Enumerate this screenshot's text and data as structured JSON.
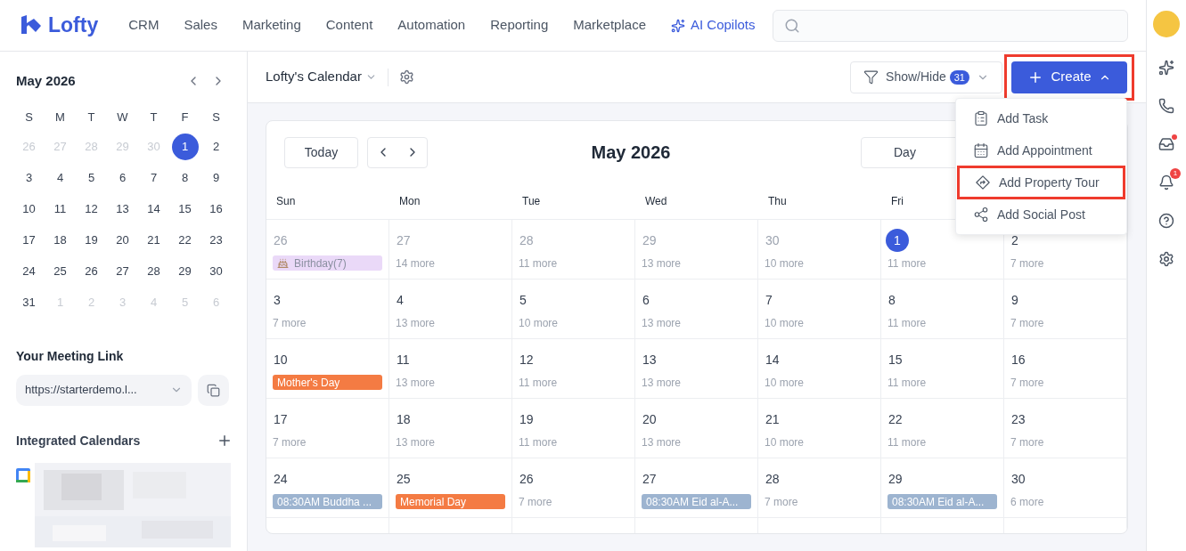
{
  "nav": {
    "logo": "Lofty",
    "items": [
      {
        "label": "CRM",
        "kind": "plain"
      },
      {
        "label": "Sales",
        "kind": "plain"
      },
      {
        "label": "Marketing",
        "kind": "plain"
      },
      {
        "label": "Content",
        "kind": "plain"
      },
      {
        "label": "Automation",
        "kind": "plain"
      },
      {
        "label": "Reporting",
        "kind": "plain"
      },
      {
        "label": "Marketplace",
        "kind": "plain"
      },
      {
        "label": "AI Copilots",
        "kind": "ai"
      }
    ]
  },
  "rail": {
    "inbox_unread": true,
    "notifications_badge": "1"
  },
  "mini_calendar": {
    "title": "May 2026",
    "weekdays": [
      "S",
      "M",
      "T",
      "W",
      "T",
      "F",
      "S"
    ],
    "weeks": [
      [
        {
          "day": "26",
          "muted": true,
          "selected": false
        },
        {
          "day": "27",
          "muted": true,
          "selected": false
        },
        {
          "day": "28",
          "muted": true,
          "selected": false
        },
        {
          "day": "29",
          "muted": true,
          "selected": false
        },
        {
          "day": "30",
          "muted": true,
          "selected": false
        },
        {
          "day": "1",
          "muted": false,
          "selected": true
        },
        {
          "day": "2",
          "muted": false,
          "selected": false
        }
      ],
      [
        {
          "day": "3",
          "muted": false,
          "selected": false
        },
        {
          "day": "4",
          "muted": false,
          "selected": false
        },
        {
          "day": "5",
          "muted": false,
          "selected": false
        },
        {
          "day": "6",
          "muted": false,
          "selected": false
        },
        {
          "day": "7",
          "muted": false,
          "selected": false
        },
        {
          "day": "8",
          "muted": false,
          "selected": false
        },
        {
          "day": "9",
          "muted": false,
          "selected": false
        }
      ],
      [
        {
          "day": "10",
          "muted": false,
          "selected": false
        },
        {
          "day": "11",
          "muted": false,
          "selected": false
        },
        {
          "day": "12",
          "muted": false,
          "selected": false
        },
        {
          "day": "13",
          "muted": false,
          "selected": false
        },
        {
          "day": "14",
          "muted": false,
          "selected": false
        },
        {
          "day": "15",
          "muted": false,
          "selected": false
        },
        {
          "day": "16",
          "muted": false,
          "selected": false
        }
      ],
      [
        {
          "day": "17",
          "muted": false,
          "selected": false
        },
        {
          "day": "18",
          "muted": false,
          "selected": false
        },
        {
          "day": "19",
          "muted": false,
          "selected": false
        },
        {
          "day": "20",
          "muted": false,
          "selected": false
        },
        {
          "day": "21",
          "muted": false,
          "selected": false
        },
        {
          "day": "22",
          "muted": false,
          "selected": false
        },
        {
          "day": "23",
          "muted": false,
          "selected": false
        }
      ],
      [
        {
          "day": "24",
          "muted": false,
          "selected": false
        },
        {
          "day": "25",
          "muted": false,
          "selected": false
        },
        {
          "day": "26",
          "muted": false,
          "selected": false
        },
        {
          "day": "27",
          "muted": false,
          "selected": false
        },
        {
          "day": "28",
          "muted": false,
          "selected": false
        },
        {
          "day": "29",
          "muted": false,
          "selected": false
        },
        {
          "day": "30",
          "muted": false,
          "selected": false
        }
      ],
      [
        {
          "day": "31",
          "muted": false,
          "selected": false
        },
        {
          "day": "1",
          "muted": true,
          "selected": false
        },
        {
          "day": "2",
          "muted": true,
          "selected": false
        },
        {
          "day": "3",
          "muted": true,
          "selected": false
        },
        {
          "day": "4",
          "muted": true,
          "selected": false
        },
        {
          "day": "5",
          "muted": true,
          "selected": false
        },
        {
          "day": "6",
          "muted": true,
          "selected": false
        }
      ]
    ]
  },
  "meeting_link": {
    "title": "Your Meeting Link",
    "value": "https://starterdemo.l..."
  },
  "integrated_calendars": {
    "title": "Integrated Calendars"
  },
  "toolbar": {
    "calendar_name": "Lofty's Calendar",
    "show_hide": {
      "label": "Show/Hide",
      "count": "31"
    },
    "create": {
      "label": "Create",
      "highlighted": true
    }
  },
  "create_menu": [
    {
      "label": "Add Task",
      "kind": "task",
      "highlighted": false
    },
    {
      "label": "Add Appointment",
      "kind": "appointment",
      "highlighted": false
    },
    {
      "label": "Add Property Tour",
      "kind": "tour",
      "highlighted": true
    },
    {
      "label": "Add Social Post",
      "kind": "social",
      "highlighted": false
    }
  ],
  "calendar": {
    "today_button": "Today",
    "title": "May 2026",
    "view": "Day",
    "weekdays": [
      "Sun",
      "Mon",
      "Tue",
      "Wed",
      "Thu",
      "Fri"
    ],
    "weeks": [
      [
        {
          "day": "26",
          "muted": true,
          "today": false,
          "event": {
            "label": "Birthday(7)",
            "kind": "birthday",
            "color": "#ead9f8"
          }
        },
        {
          "day": "27",
          "muted": true,
          "today": false,
          "more": "14 more"
        },
        {
          "day": "28",
          "muted": true,
          "today": false,
          "more": "11 more"
        },
        {
          "day": "29",
          "muted": true,
          "today": false,
          "more": "13 more"
        },
        {
          "day": "30",
          "muted": true,
          "today": false,
          "more": "10 more"
        },
        {
          "day": "1",
          "muted": false,
          "today": true,
          "more": "11 more"
        },
        {
          "day": "2",
          "muted": false,
          "today": false,
          "more": "7 more"
        }
      ],
      [
        {
          "day": "3",
          "muted": false,
          "today": false,
          "more": "7 more"
        },
        {
          "day": "4",
          "muted": false,
          "today": false,
          "more": "13 more"
        },
        {
          "day": "5",
          "muted": false,
          "today": false,
          "more": "10 more"
        },
        {
          "day": "6",
          "muted": false,
          "today": false,
          "more": "13 more"
        },
        {
          "day": "7",
          "muted": false,
          "today": false,
          "more": "10 more"
        },
        {
          "day": "8",
          "muted": false,
          "today": false,
          "more": "11 more"
        },
        {
          "day": "9",
          "muted": false,
          "today": false,
          "more": "7 more"
        }
      ],
      [
        {
          "day": "10",
          "muted": false,
          "today": false,
          "event": {
            "label": "Mother's Day",
            "kind": "plain",
            "color": "#f47b43"
          }
        },
        {
          "day": "11",
          "muted": false,
          "today": false,
          "more": "13 more"
        },
        {
          "day": "12",
          "muted": false,
          "today": false,
          "more": "11 more"
        },
        {
          "day": "13",
          "muted": false,
          "today": false,
          "more": "13 more"
        },
        {
          "day": "14",
          "muted": false,
          "today": false,
          "more": "10 more"
        },
        {
          "day": "15",
          "muted": false,
          "today": false,
          "more": "11 more"
        },
        {
          "day": "16",
          "muted": false,
          "today": false,
          "more": "7 more"
        }
      ],
      [
        {
          "day": "17",
          "muted": false,
          "today": false,
          "more": "7 more"
        },
        {
          "day": "18",
          "muted": false,
          "today": false,
          "more": "13 more"
        },
        {
          "day": "19",
          "muted": false,
          "today": false,
          "more": "11 more"
        },
        {
          "day": "20",
          "muted": false,
          "today": false,
          "more": "13 more"
        },
        {
          "day": "21",
          "muted": false,
          "today": false,
          "more": "10 more"
        },
        {
          "day": "22",
          "muted": false,
          "today": false,
          "more": "11 more"
        },
        {
          "day": "23",
          "muted": false,
          "today": false,
          "more": "7 more"
        }
      ],
      [
        {
          "day": "24",
          "muted": false,
          "today": false,
          "event": {
            "label": "08:30AM Buddha ...",
            "kind": "plain",
            "color": "#9db4d0"
          }
        },
        {
          "day": "25",
          "muted": false,
          "today": false,
          "event": {
            "label": "Memorial Day",
            "kind": "plain",
            "color": "#f47b43"
          }
        },
        {
          "day": "26",
          "muted": false,
          "today": false,
          "more": "7 more"
        },
        {
          "day": "27",
          "muted": false,
          "today": false,
          "event": {
            "label": "08:30AM Eid al-A...",
            "kind": "plain",
            "color": "#9db4d0"
          }
        },
        {
          "day": "28",
          "muted": false,
          "today": false,
          "more": "7 more"
        },
        {
          "day": "29",
          "muted": false,
          "today": false,
          "event": {
            "label": "08:30AM Eid al-A...",
            "kind": "plain",
            "color": "#9db4d0"
          }
        },
        {
          "day": "30",
          "muted": false,
          "today": false,
          "more": "6 more"
        }
      ]
    ]
  }
}
